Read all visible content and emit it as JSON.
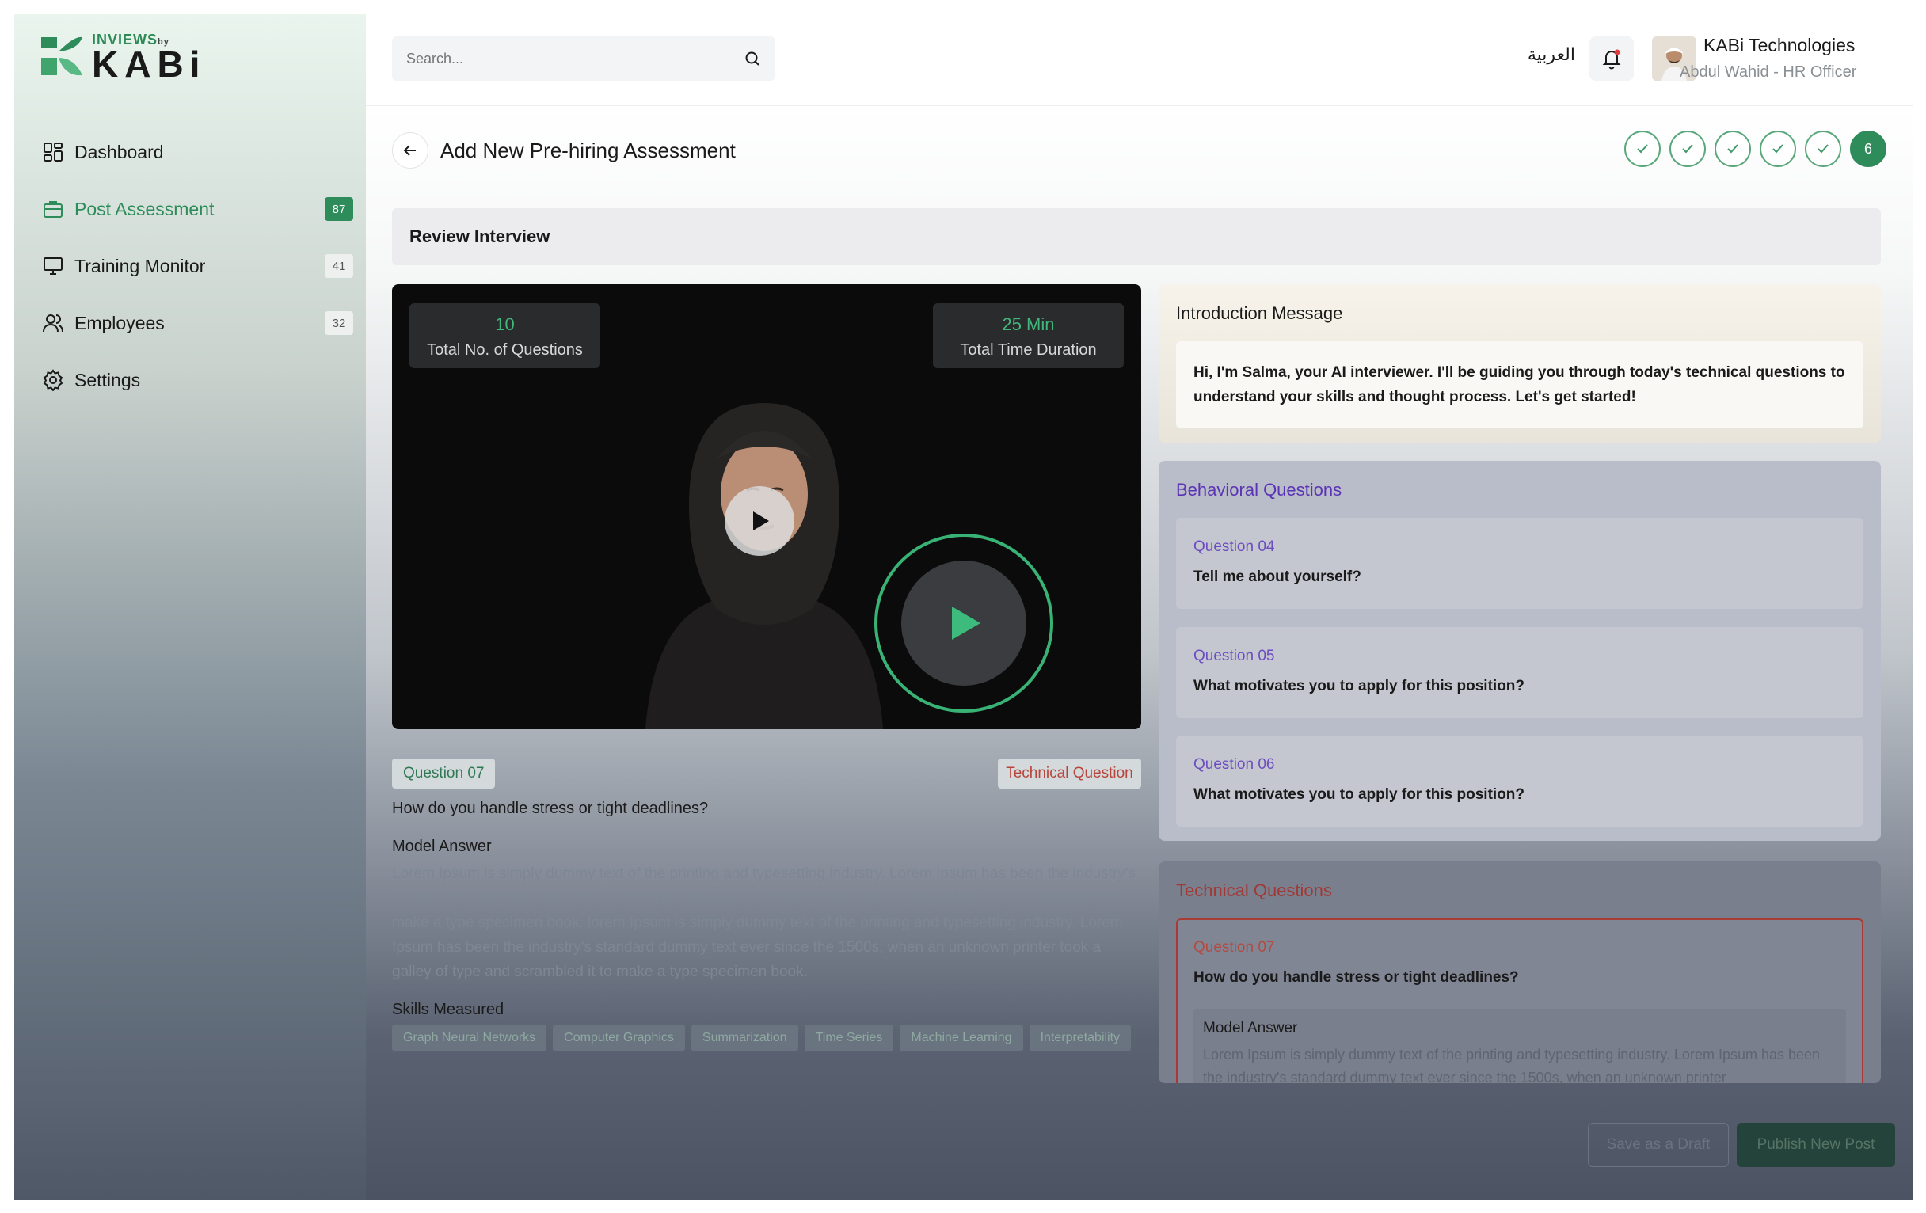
{
  "brand": {
    "top": "INVIEWS",
    "by": "by",
    "main": "KABi",
    "color": "#2e8b5a"
  },
  "sidebar": {
    "items": [
      {
        "label": "Dashboard",
        "icon": "dashboard-icon",
        "badge": null,
        "active": false
      },
      {
        "label": "Post Assessment",
        "icon": "briefcase-icon",
        "badge": "87",
        "active": true
      },
      {
        "label": "Training Monitor",
        "icon": "monitor-icon",
        "badge": "41",
        "active": false
      },
      {
        "label": "Employees",
        "icon": "users-icon",
        "badge": "32",
        "active": false
      },
      {
        "label": "Settings",
        "icon": "gear-icon",
        "badge": null,
        "active": false
      }
    ]
  },
  "header": {
    "search_placeholder": "Search...",
    "language": "العربية",
    "user_company": "KABi Technologies",
    "user_role": "Abdul Wahid - HR Officer"
  },
  "page": {
    "title": "Add New Pre-hiring Assessment",
    "current_step": "6",
    "completed_steps": 5,
    "section": "Review Interview"
  },
  "video": {
    "questions_count": "10",
    "questions_label": "Total No. of Questions",
    "duration": "25 Min",
    "duration_label": "Total Time Duration"
  },
  "question_detail": {
    "tag": "Question 07",
    "type": "Technical Question",
    "text": "How do you handle stress or tight deadlines?",
    "model_answer_label": "Model Answer",
    "model_answer": "Lorem Ipsum is simply dummy text of the printing and typesetting industry. Lorem Ipsum has been the industry's standard dummy text ever since the 1500s, when an unknown printer took a galley of type and scrambled it to make a type specimen book. lorem Ipsum is simply dummy text of the printing and typesetting industry. Lorem Ipsum has been the industry's standard dummy text ever since the 1500s, when an unknown printer took a galley of type and scrambled it to make a type specimen book.",
    "skills_label": "Skills Measured",
    "skills": [
      "Graph Neural Networks",
      "Computer Graphics",
      "Summarization",
      "Time Series",
      "Machine Learning",
      "Interpretability"
    ]
  },
  "intro": {
    "title": "Introduction Message",
    "text": "Hi, I'm Salma, your AI interviewer. I'll be guiding you through today's technical questions to understand your skills and thought process. Let's get started!"
  },
  "behavioral": {
    "title": "Behavioral Questions",
    "items": [
      {
        "num": "Question 04",
        "text": "Tell me about yourself?"
      },
      {
        "num": "Question 05",
        "text": "What motivates you to apply for this position?"
      },
      {
        "num": "Question 06",
        "text": "What motivates you to apply for this position?"
      }
    ]
  },
  "technical": {
    "title": "Technical Questions",
    "items": [
      {
        "num": "Question 07",
        "text": "How do you handle stress or tight deadlines?",
        "answer_label": "Model Answer",
        "answer": "Lorem Ipsum is simply dummy text of the printing and typesetting industry. Lorem Ipsum has been the industry's standard dummy text ever since the 1500s, when an unknown printer"
      }
    ]
  },
  "footer": {
    "draft_label": "Save as a Draft",
    "publish_label": "Publish New Post"
  }
}
